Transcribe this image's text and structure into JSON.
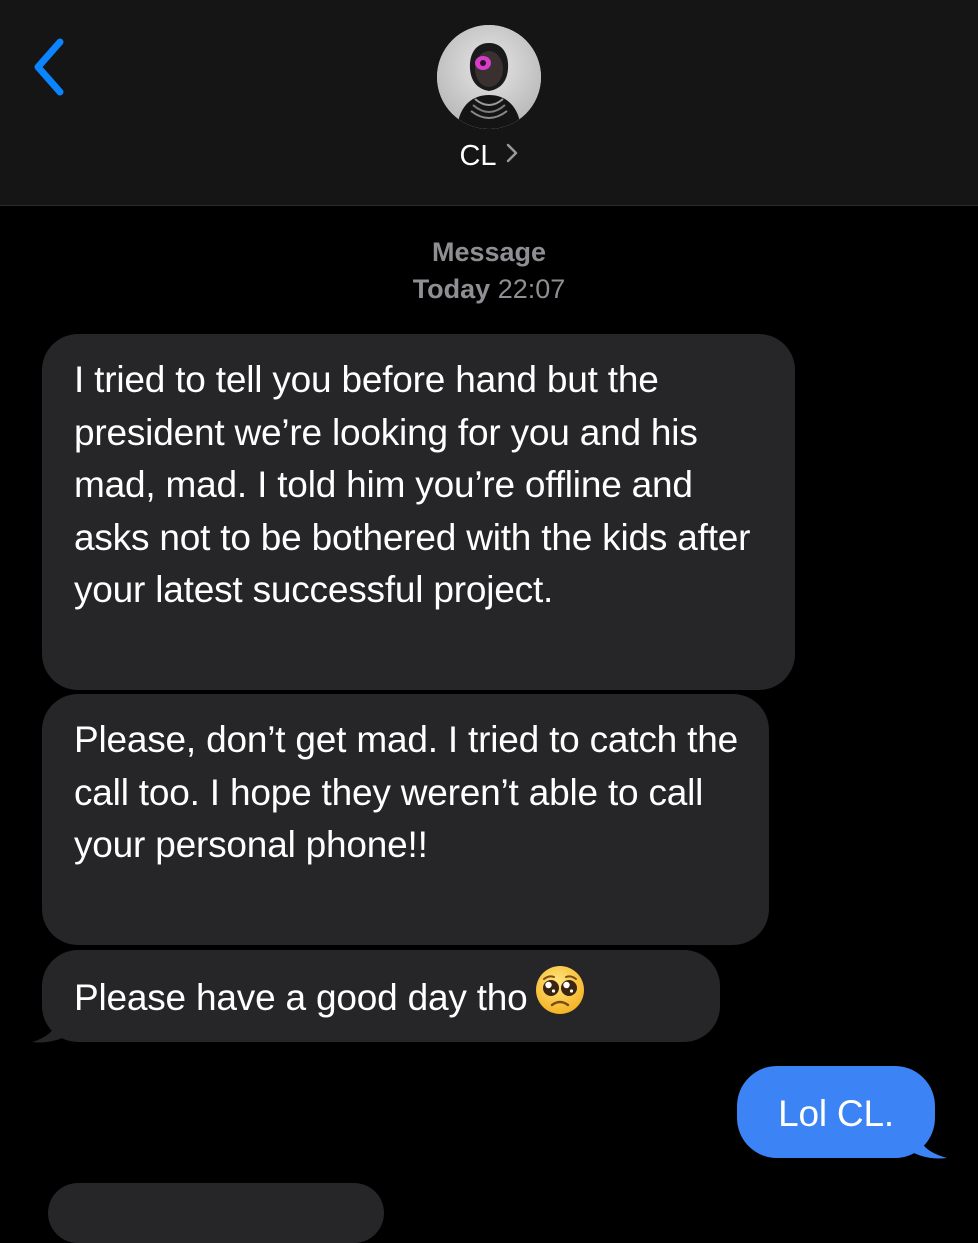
{
  "header": {
    "back_icon": "chevron-left-icon",
    "contact_name": "CL",
    "chevron_icon": "chevron-right-icon",
    "accent_color": "#0a84ff"
  },
  "thread": {
    "service_label": "Message",
    "timestamp_day": "Today",
    "timestamp_time": "22:07"
  },
  "messages": [
    {
      "direction": "incoming",
      "text": "I tried to tell you before hand but the president we’re looking for you and his mad, mad. I told him you’re offline and asks not to be bothered with the kids after your latest successful project."
    },
    {
      "direction": "incoming",
      "text": "Please, don’t get mad. I tried to catch the call too. I hope they weren’t able to call your personal phone!!"
    },
    {
      "direction": "incoming",
      "text": "Please have a good day tho",
      "emoji_icon": "pleading-face-emoji"
    },
    {
      "direction": "outgoing",
      "text": "Lol CL."
    },
    {
      "direction": "incoming",
      "text": ""
    }
  ],
  "colors": {
    "incoming_bubble": "#262628",
    "outgoing_bubble": "#3c83f6",
    "header_background": "#151515",
    "meta_text": "#8e8e93"
  }
}
